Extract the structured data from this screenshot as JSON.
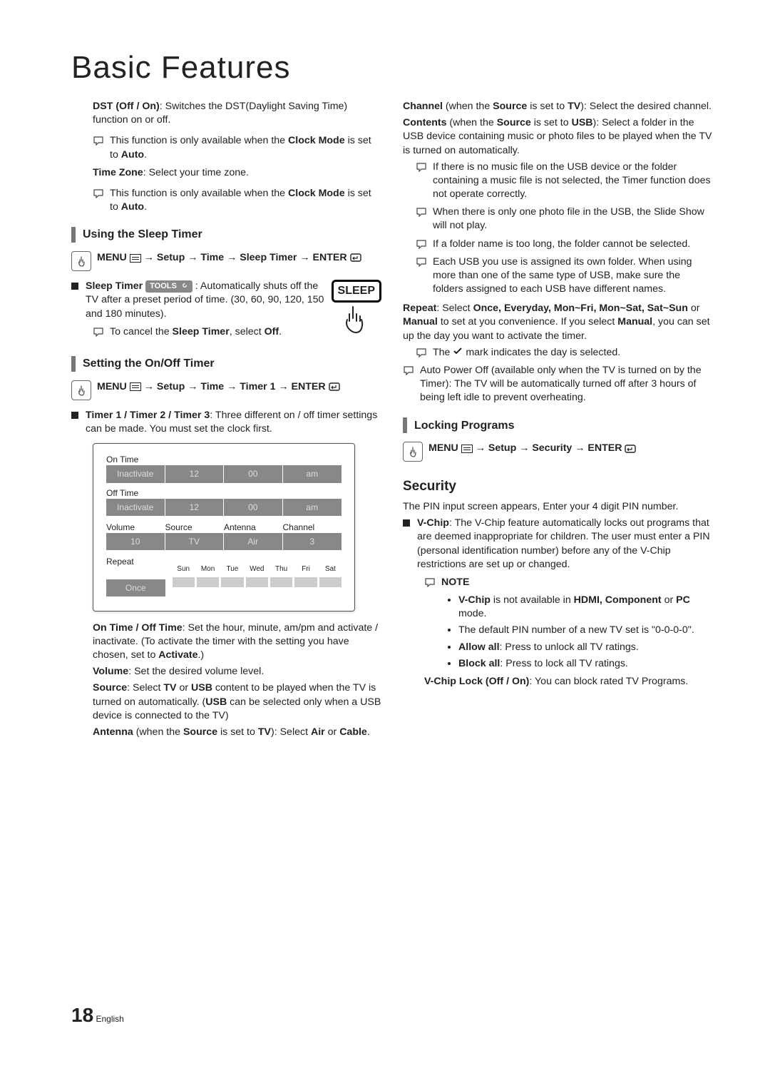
{
  "page_title": "Basic Features",
  "page_number": "18",
  "page_lang": "English",
  "dst": {
    "label_full": "DST (Off / On)",
    "desc": ": Switches the DST(Daylight Saving Time) function on or off.",
    "note": "This function is only available when the ",
    "note_bold1": "Clock Mode",
    "note_mid": " is set to ",
    "note_bold2": "Auto",
    "note_end": "."
  },
  "timezone": {
    "label": "Time Zone",
    "desc": ": Select your time zone.",
    "note": "This function is only available when the ",
    "note_bold1": "Clock Mode",
    "note_mid": " is set to ",
    "note_bold2": "Auto",
    "note_end": "."
  },
  "sleep_section": {
    "heading": "Using the Sleep Timer",
    "menu_label": "MENU",
    "path": " → Setup → Time → Sleep Timer → ENTER",
    "item_label": "Sleep Timer",
    "tools_label": "TOOLS",
    "desc": " : Automatically shuts off the TV after a preset period of time. (30, 60, 90, 120, 150 and 180 minutes).",
    "note_pre": "To cancel the ",
    "note_bold": "Sleep Timer",
    "note_mid": ", select ",
    "note_bold2": "Off",
    "note_end": ".",
    "sleep_icon_label": "SLEEP"
  },
  "onoff_section": {
    "heading": "Setting the On/Off Timer",
    "menu_label": "MENU",
    "path": " → Setup → Time → Timer 1 → ENTER",
    "item_label": "Timer 1 / Timer 2 / Timer 3",
    "desc": ": Three different on / off timer settings can be made. You must set the clock first."
  },
  "timer_panel": {
    "on_time_label": "On Time",
    "off_time_label": "Off Time",
    "inactivate": "Inactivate",
    "hours": "12",
    "minutes": "00",
    "ampm": "am",
    "vol_label": "Volume",
    "vol_val": "10",
    "source_label": "Source",
    "source_val": "TV",
    "antenna_label": "Antenna",
    "antenna_val": "Air",
    "channel_label": "Channel",
    "channel_val": "3",
    "repeat_label": "Repeat",
    "repeat_val": "Once",
    "days": [
      "Sun",
      "Mon",
      "Tue",
      "Wed",
      "Thu",
      "Fri",
      "Sat"
    ]
  },
  "onoff_body": {
    "ontime_label": "On Time / Off Time",
    "ontime_desc": ": Set the hour, minute, am/pm and activate / inactivate. (To activate the timer with the setting you have chosen, set to ",
    "ontime_bold": "Activate",
    "ontime_end": ".)",
    "vol_label": "Volume",
    "vol_desc": ": Set the desired volume level.",
    "src_label": "Source",
    "src_desc1": ": Select ",
    "src_b1": "TV",
    "src_desc2": " or ",
    "src_b2": "USB",
    "src_desc3": " content to be played when the TV is turned on automatically. (",
    "src_b3": "USB",
    "src_desc4": " can be selected only when a USB device is connected to the TV)",
    "ant_label": "Antenna",
    "ant_desc1": " (when the ",
    "ant_b1": "Source",
    "ant_desc2": " is set to ",
    "ant_b2": "TV",
    "ant_desc3": "): Select ",
    "ant_b3": "Air",
    "ant_desc4": " or ",
    "ant_b4": "Cable",
    "ant_end": "."
  },
  "right_col": {
    "ch_label": "Channel",
    "ch_desc1": " (when the ",
    "ch_b1": "Source",
    "ch_desc2": " is set to ",
    "ch_b2": "TV",
    "ch_desc3": "): Select the desired channel.",
    "con_label": "Contents",
    "con_desc1": " (when the ",
    "con_b1": "Source",
    "con_desc2": " is set to ",
    "con_b2": "USB",
    "con_desc3": "): Select a folder in the USB device containing music or photo files to be played when the TV is turned on automatically.",
    "usb_note1": "If there is no music file on the USB device or the folder containing a music file is not selected, the Timer function does not operate correctly.",
    "usb_note2": "When there is only one photo file in the USB, the Slide Show will not play.",
    "usb_note3": "If a folder name is too long, the folder cannot be selected.",
    "usb_note4": "Each USB you use is assigned its own folder. When using more than one of the same type of USB, make sure the folders assigned to each USB have different names.",
    "rep_label": "Repeat",
    "rep_desc1": ": Select ",
    "rep_opts": "Once, Everyday, Mon~Fri, Mon~Sat, Sat~Sun",
    "rep_desc2": " or ",
    "rep_b": "Manual",
    "rep_desc3": " to set at you convenience. If you select ",
    "rep_b2": "Manual",
    "rep_desc4": ", you can set up the day you want to activate the timer.",
    "rep_note": "The ",
    "rep_note2": " mark indicates the day is selected.",
    "autopower": "Auto Power Off (available only when the TV is turned on by the Timer): The TV will be automatically turned off after 3 hours of being left idle to prevent overheating."
  },
  "locking": {
    "heading": "Locking Programs",
    "menu_label": "MENU",
    "path": " → Setup → Security → ENTER"
  },
  "security": {
    "heading": "Security",
    "intro": "The PIN input screen appears, Enter your 4 digit PIN number.",
    "vchip_label": "V-Chip",
    "vchip_desc": ": The V-Chip feature automatically locks out programs that are deemed inappropriate for children. The user must enter a PIN (personal identification number) before any of the V-Chip restrictions are set up or changed.",
    "note_label": "NOTE",
    "b1_pre": "V-Chip",
    "b1": " is not available in ",
    "b1_bold": "HDMI, Component",
    "b1_mid": " or ",
    "b1_bold2": "PC",
    "b1_end": " mode.",
    "b2": "The default PIN number of a new TV set is \"0-0-0-0\".",
    "b3_bold": "Allow all",
    "b3": ": Press to unlock all TV ratings.",
    "b4_bold": "Block all",
    "b4": ": Press to lock all TV ratings.",
    "lock_label": "V-Chip Lock (Off / On)",
    "lock_desc": ": You can block rated TV Programs."
  }
}
